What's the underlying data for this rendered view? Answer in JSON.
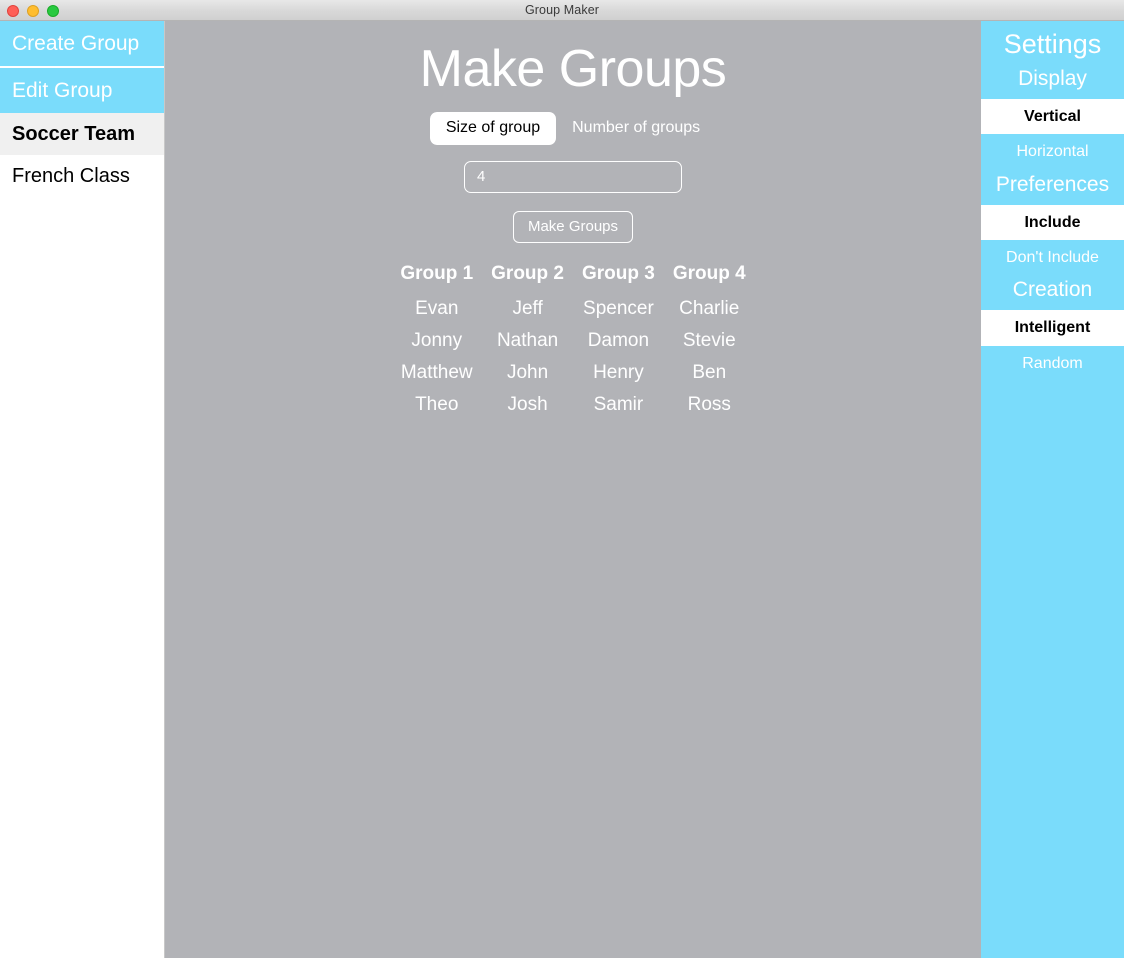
{
  "window": {
    "title": "Group Maker",
    "traffic_lights": [
      "close",
      "minimize",
      "maximize"
    ]
  },
  "sidebar": {
    "actions": [
      {
        "label": "Create Group"
      },
      {
        "label": "Edit Group"
      }
    ],
    "groups": [
      {
        "label": "Soccer Team",
        "selected": true
      },
      {
        "label": "French Class",
        "selected": false
      }
    ]
  },
  "main": {
    "title": "Make Groups",
    "mode_toggle": {
      "options": [
        {
          "label": "Size of group",
          "active": true
        },
        {
          "label": "Number of groups",
          "active": false
        }
      ]
    },
    "count_input": {
      "value": "4",
      "placeholder": ""
    },
    "make_button": {
      "label": "Make Groups"
    },
    "results": {
      "headers": [
        "Group 1",
        "Group 2",
        "Group 3",
        "Group 4"
      ],
      "rows": [
        [
          "Evan",
          "Jeff",
          "Spencer",
          "Charlie"
        ],
        [
          "Jonny",
          "Nathan",
          "Damon",
          "Stevie"
        ],
        [
          "Matthew",
          "John",
          "Henry",
          "Ben"
        ],
        [
          "Theo",
          "Josh",
          "Samir",
          "Ross"
        ]
      ]
    }
  },
  "settings": {
    "title": "Settings",
    "sections": [
      {
        "heading": "Display",
        "options": [
          {
            "label": "Vertical",
            "selected": true
          },
          {
            "label": "Horizontal",
            "selected": false
          }
        ]
      },
      {
        "heading": "Preferences",
        "options": [
          {
            "label": "Include",
            "selected": true
          },
          {
            "label": "Don't Include",
            "selected": false
          }
        ]
      },
      {
        "heading": "Creation",
        "options": [
          {
            "label": "Intelligent",
            "selected": true
          },
          {
            "label": "Random",
            "selected": false
          }
        ]
      }
    ]
  },
  "colors": {
    "accent_blue": "#7adcfb",
    "main_gray": "#b2b3b7",
    "selected_gray": "#f0f0f0",
    "white": "#ffffff"
  }
}
